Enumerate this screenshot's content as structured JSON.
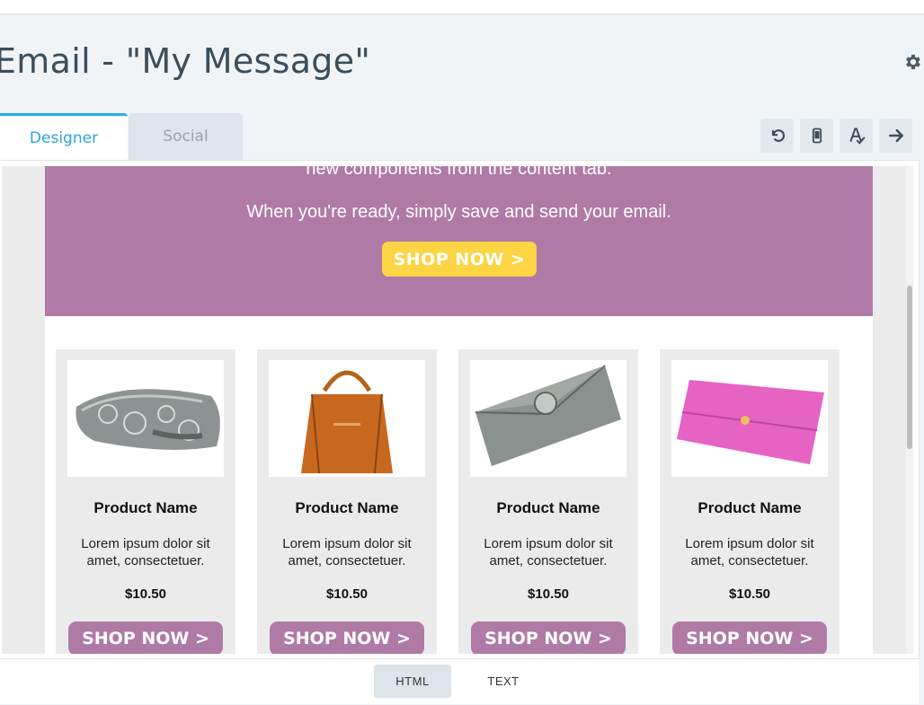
{
  "header": {
    "title": "Email - \"My Message\"",
    "settings_icon": "gear-icon"
  },
  "tabs": [
    {
      "label": "Designer",
      "active": true
    },
    {
      "label": "Social",
      "active": false
    }
  ],
  "toolbar": {
    "icons": [
      "undo-icon",
      "mobile-preview-icon",
      "spellcheck-icon",
      "next-arrow-icon"
    ]
  },
  "email": {
    "hero": {
      "line_partial": "new components from the content tab.",
      "line_main": "When you're ready, simply save and send your email.",
      "button_label": "SHOP NOW >",
      "background": "#b07aa6",
      "button_color": "#fcd444"
    },
    "products": [
      {
        "name": "Product Name",
        "description": "Lorem ipsum dolor sit amet, consectetuer.",
        "price": "$10.50",
        "button_label": "SHOP NOW >",
        "image": "beaded-silver-clutch"
      },
      {
        "name": "Product Name",
        "description": "Lorem ipsum dolor sit amet, consectetuer.",
        "price": "$10.50",
        "button_label": "SHOP NOW >",
        "image": "brown-leather-handbag"
      },
      {
        "name": "Product Name",
        "description": "Lorem ipsum dolor sit amet, consectetuer.",
        "price": "$10.50",
        "button_label": "SHOP NOW >",
        "image": "grey-envelope-clutch"
      },
      {
        "name": "Product Name",
        "description": "Lorem ipsum dolor sit amet, consectetuer.",
        "price": "$10.50",
        "button_label": "SHOP NOW >",
        "image": "pink-wallet"
      }
    ]
  },
  "footer": {
    "modes": [
      {
        "label": "HTML",
        "active": true
      },
      {
        "label": "TEXT",
        "active": false
      }
    ]
  },
  "colors": {
    "accent": "#22aee7",
    "title": "#3b4e5c"
  }
}
